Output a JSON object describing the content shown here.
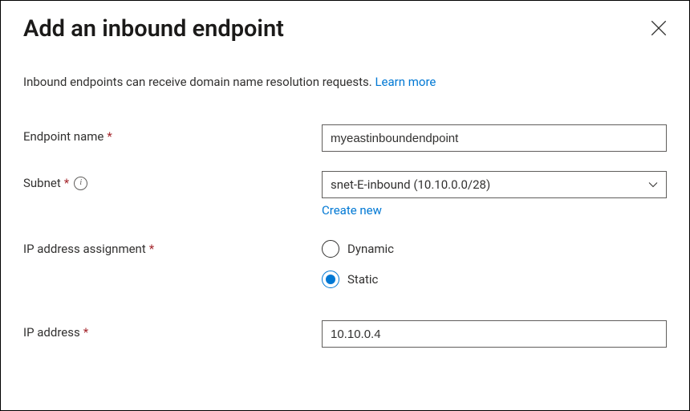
{
  "panel": {
    "title": "Add an inbound endpoint",
    "description_text": "Inbound endpoints can receive domain name resolution requests. ",
    "learn_more": "Learn more"
  },
  "form": {
    "endpoint_name": {
      "label": "Endpoint name",
      "value": "myeastinboundendpoint"
    },
    "subnet": {
      "label": "Subnet",
      "selected": "snet-E-inbound (10.10.0.0/28)",
      "create_new": "Create new"
    },
    "ip_assignment": {
      "label": "IP address assignment",
      "options": {
        "dynamic": "Dynamic",
        "static": "Static"
      },
      "selected": "static"
    },
    "ip_address": {
      "label": "IP address",
      "value": "10.10.0.4"
    }
  }
}
